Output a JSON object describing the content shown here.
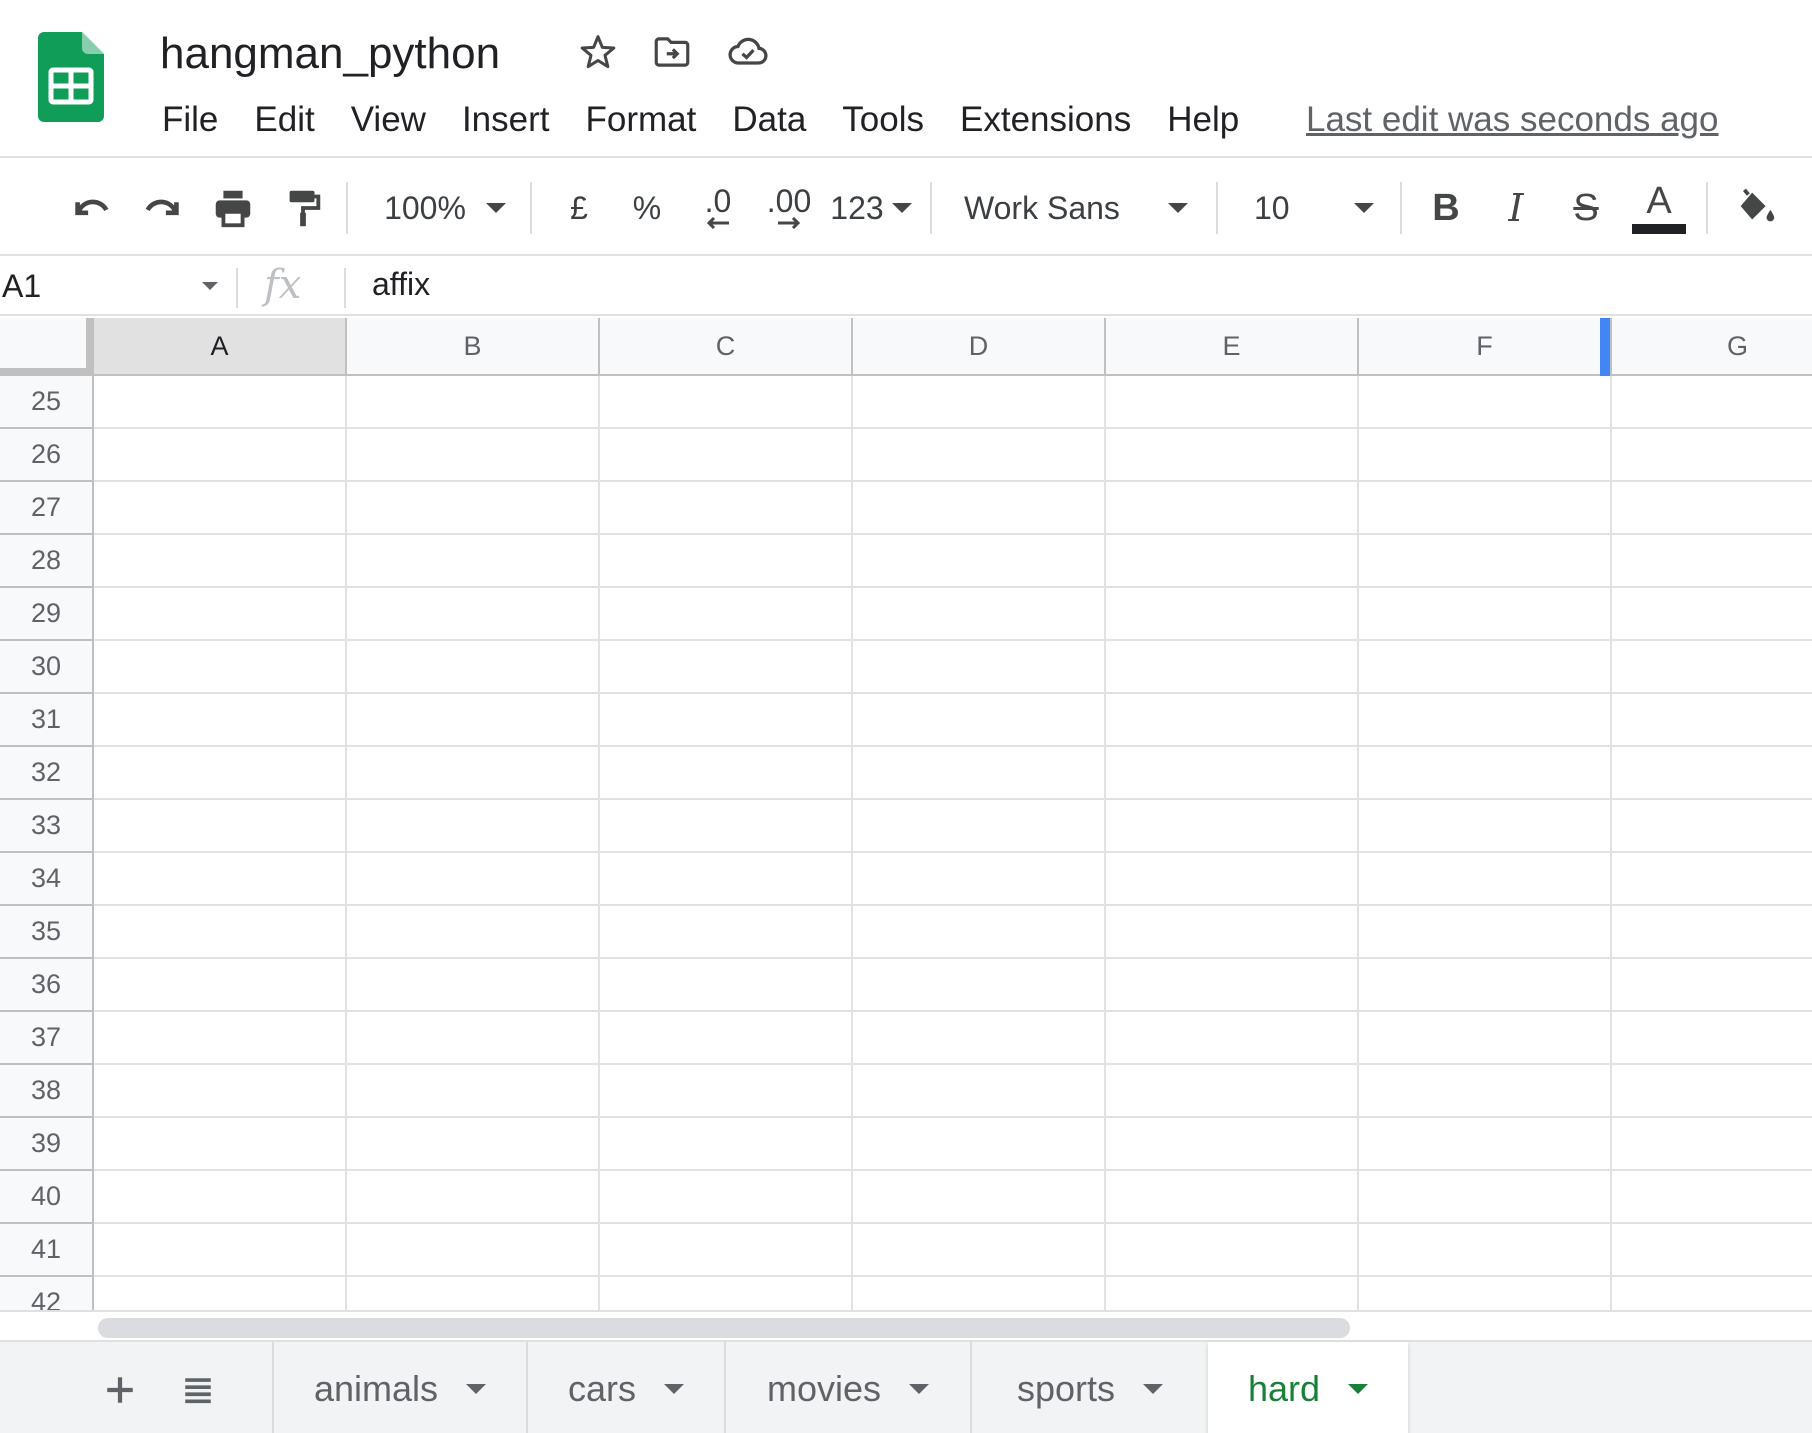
{
  "header": {
    "doc_title": "hangman_python",
    "last_edit": "Last edit was seconds ago",
    "menu": [
      "File",
      "Edit",
      "View",
      "Insert",
      "Format",
      "Data",
      "Tools",
      "Extensions",
      "Help"
    ],
    "brand_color": "#0f9d58"
  },
  "toolbar": {
    "zoom": "100%",
    "currency": "£",
    "percent": "%",
    "decrease_decimals": ".0",
    "increase_decimals": ".00",
    "more_formats": "123",
    "font": "Work Sans",
    "font_size": "10",
    "bold": "B",
    "italic": "I",
    "strikethrough": "S",
    "text_color": "A"
  },
  "formula_bar": {
    "cell_ref": "A1",
    "fx": "fx",
    "value": "affix"
  },
  "grid": {
    "columns": [
      "A",
      "B",
      "C",
      "D",
      "E",
      "F",
      "G"
    ],
    "selected_column": "A",
    "rows": [
      "25",
      "26",
      "27",
      "28",
      "29",
      "30",
      "31",
      "32",
      "33",
      "34",
      "35",
      "36",
      "37",
      "38",
      "39",
      "40",
      "41",
      "42"
    ]
  },
  "sheets": {
    "tabs": [
      "animals",
      "cars",
      "movies",
      "sports",
      "hard"
    ],
    "active": "hard",
    "active_color": "#188038"
  }
}
